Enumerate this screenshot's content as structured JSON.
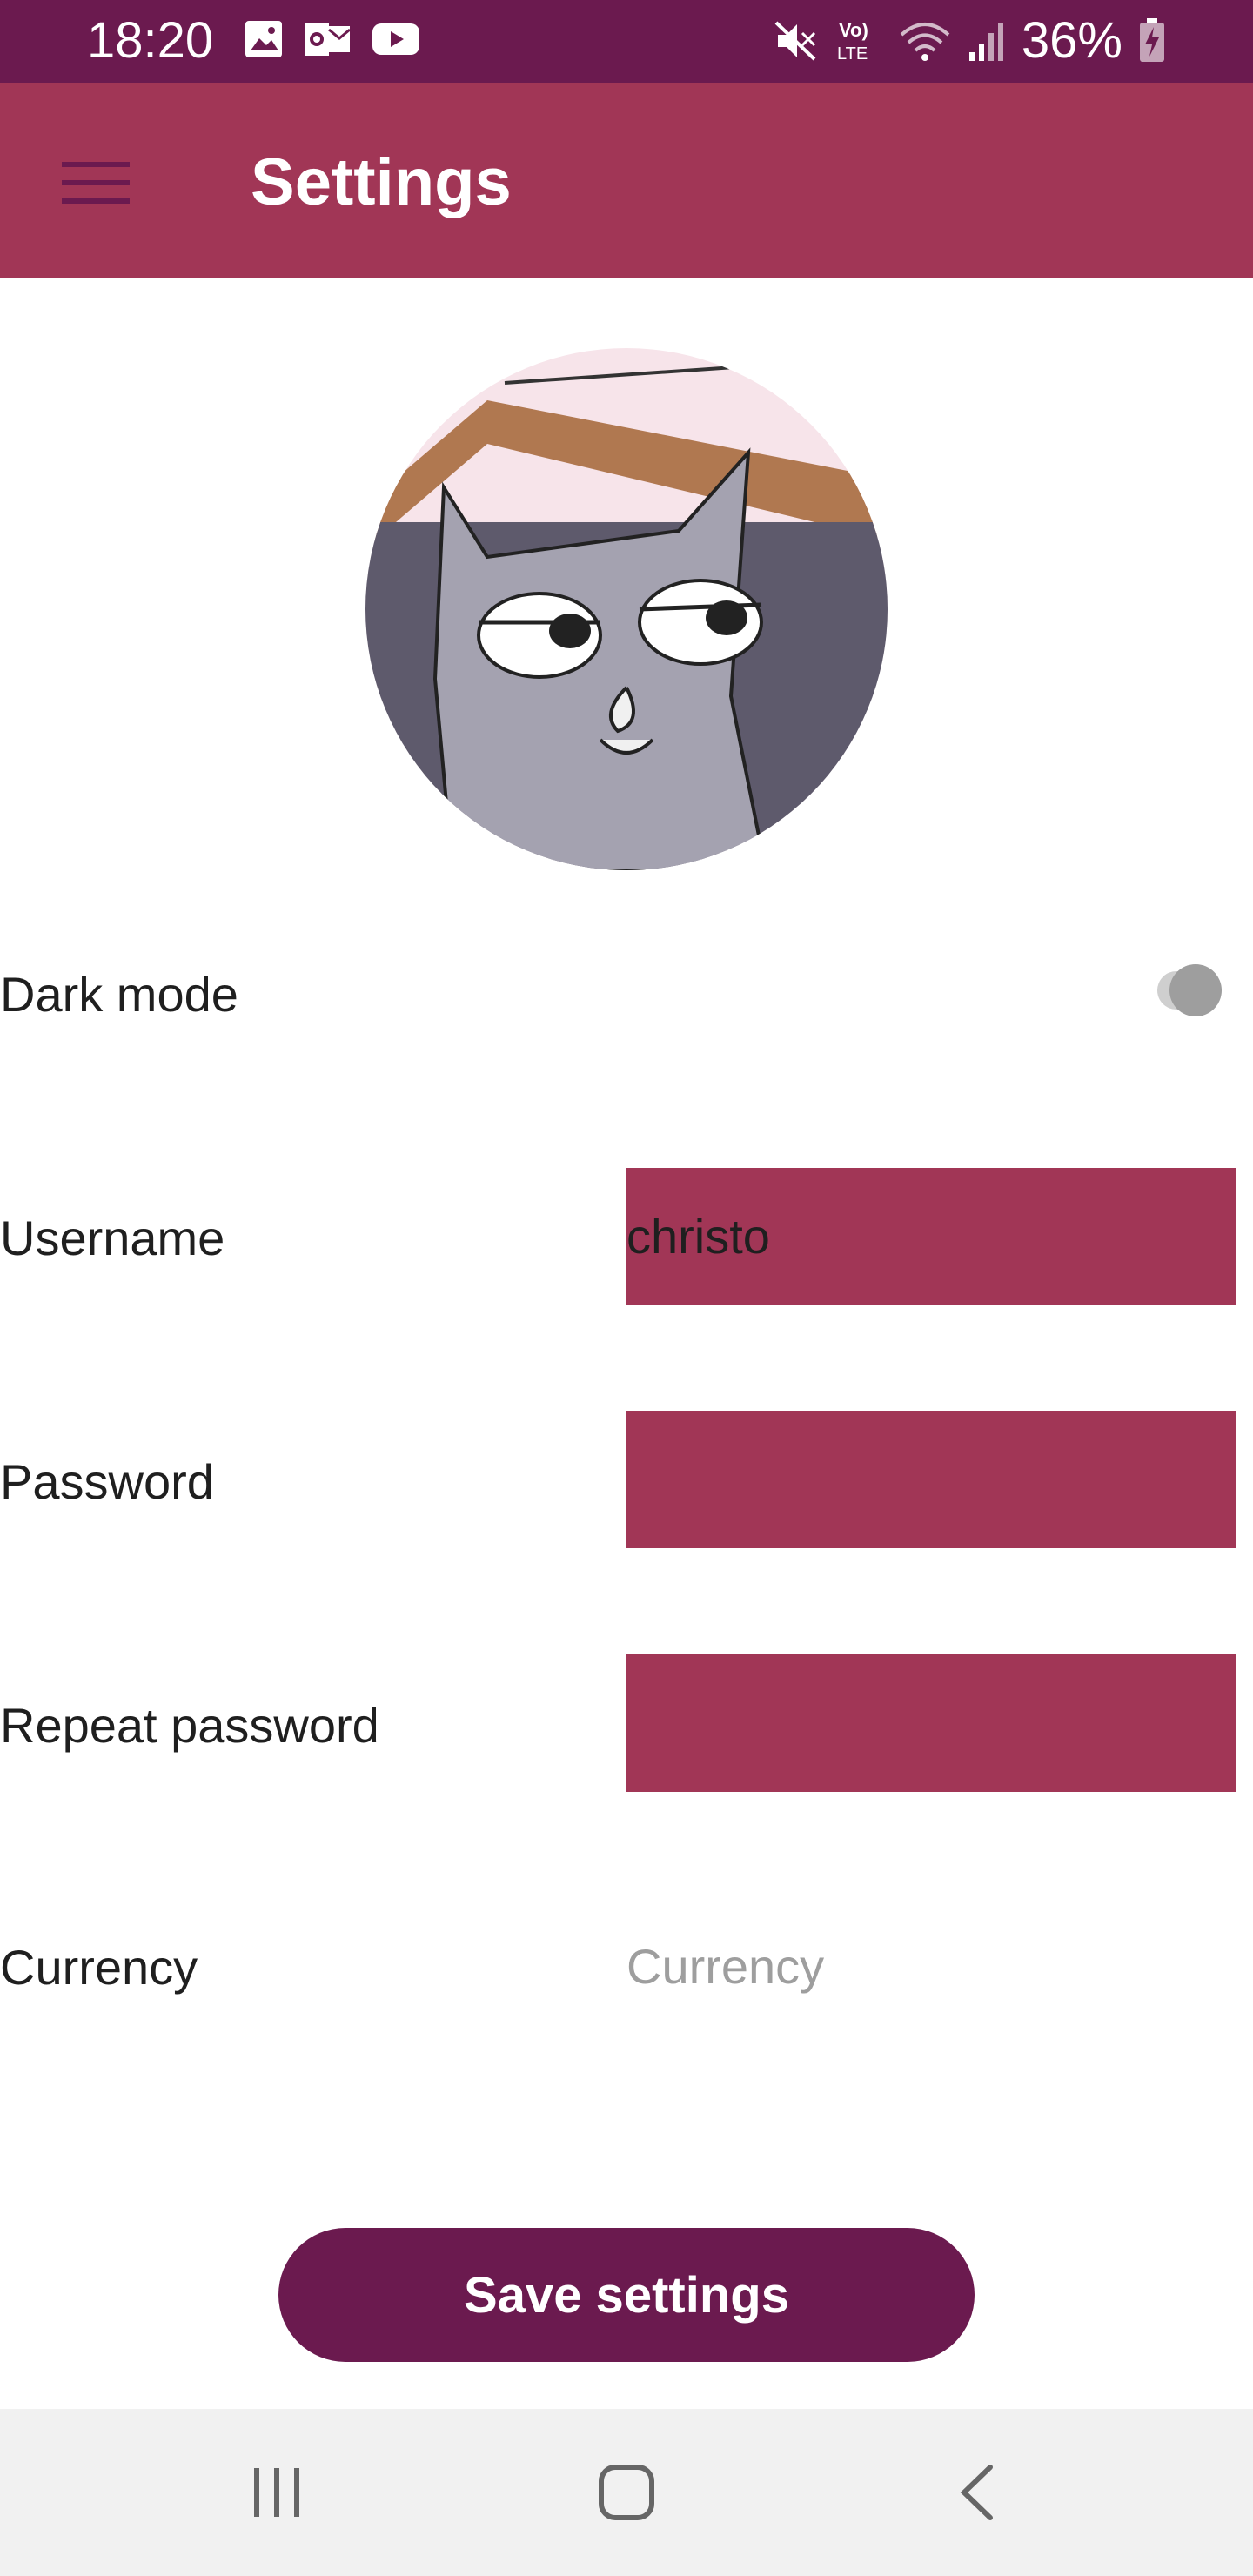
{
  "status_bar": {
    "time": "18:20",
    "battery_percent": "36%",
    "background": "#6b1a4f",
    "left_icons": [
      "image-icon",
      "outlook-icon",
      "youtube-icon"
    ],
    "right_icons": [
      "mute-icon",
      "volte-icon",
      "wifi-icon",
      "signal-icon",
      "battery-charging-icon"
    ]
  },
  "app_bar": {
    "title": "Settings",
    "menu_icon": "hamburger-menu-icon",
    "background": "#a13656"
  },
  "avatar": {
    "description_icon": "cartoon-cat-avatar"
  },
  "settings": {
    "dark_mode": {
      "label": "Dark mode",
      "enabled": false
    },
    "username": {
      "label": "Username",
      "value": "christo"
    },
    "password": {
      "label": "Password",
      "value": ""
    },
    "repeat_password": {
      "label": "Repeat password",
      "value": ""
    },
    "currency": {
      "label": "Currency",
      "placeholder": "Currency"
    }
  },
  "save_button": {
    "label": "Save settings",
    "background": "#6b1a4f"
  },
  "nav_bar": {
    "buttons": [
      "recent-apps-icon",
      "home-icon",
      "back-icon"
    ]
  }
}
